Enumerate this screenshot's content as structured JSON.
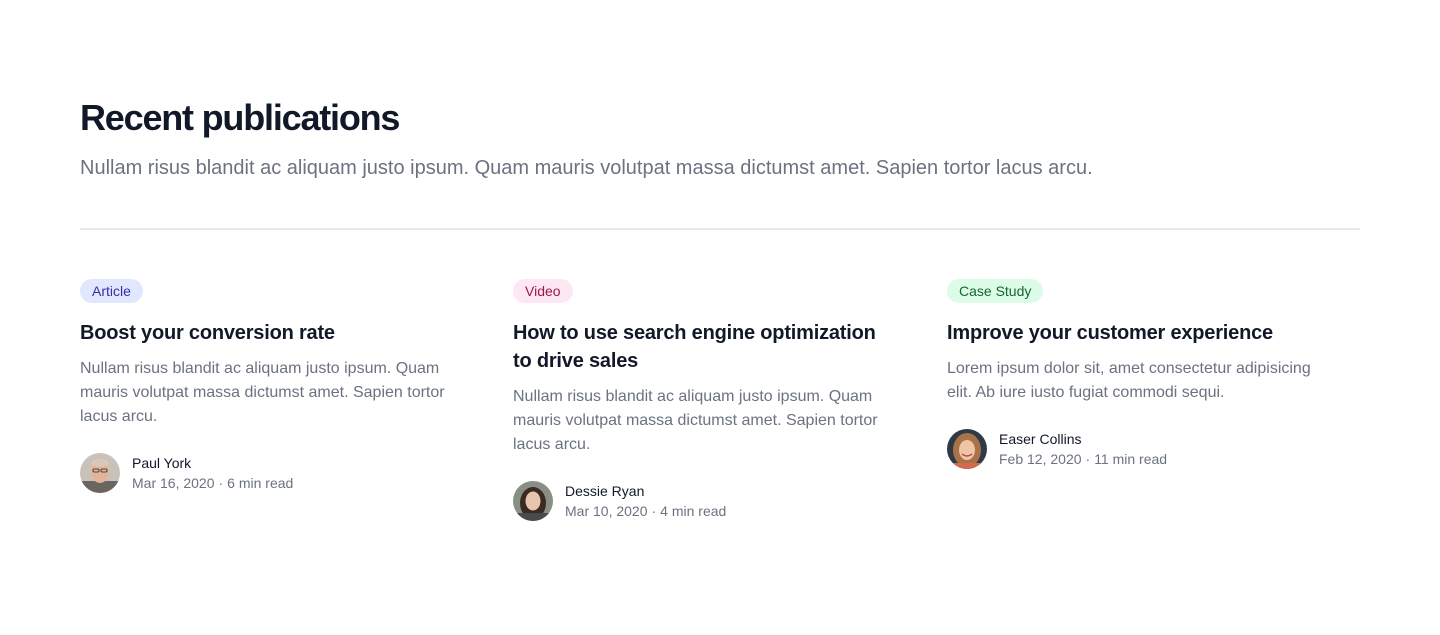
{
  "section": {
    "title": "Recent publications",
    "subtitle": "Nullam risus blandit ac aliquam justo ipsum. Quam mauris volutpat massa dictumst amet. Sapien tortor lacus arcu."
  },
  "posts": [
    {
      "category": "Article",
      "category_bg": "#e0e7ff",
      "category_color": "#3730a3",
      "title": "Boost your conversion rate",
      "excerpt": "Nullam risus blandit ac aliquam justo ipsum. Quam mauris volutpat massa dictumst amet. Sapien tortor lacus arcu.",
      "author": "Paul York",
      "date": "Mar 16, 2020",
      "separator": "·",
      "read_time": "6 min read",
      "avatar_icon": "person-avatar"
    },
    {
      "category": "Video",
      "category_bg": "#fce7f3",
      "category_color": "#9d174d",
      "title": "How to use search engine optimization to drive sales",
      "excerpt": "Nullam risus blandit ac aliquam justo ipsum. Quam mauris volutpat massa dictumst amet. Sapien tortor lacus arcu.",
      "author": "Dessie Ryan",
      "date": "Mar 10, 2020",
      "separator": "·",
      "read_time": "4 min read",
      "avatar_icon": "person-avatar"
    },
    {
      "category": "Case Study",
      "category_bg": "#dcfce7",
      "category_color": "#166534",
      "title": "Improve your customer experience",
      "excerpt": "Lorem ipsum dolor sit, amet consectetur adipisicing elit. Ab iure iusto fugiat commodi sequi.",
      "author": "Easer Collins",
      "date": "Feb 12, 2020",
      "separator": "·",
      "read_time": "11 min read",
      "avatar_icon": "person-avatar"
    }
  ]
}
